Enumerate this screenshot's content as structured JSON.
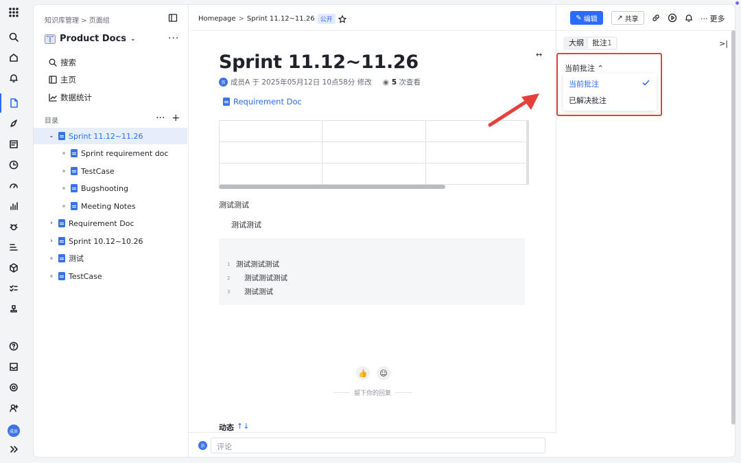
{
  "app": {
    "breadcrumb": "知识库管理 > 页面组",
    "space_name": "Product Docs"
  },
  "sidebar": {
    "nav": [
      {
        "label": "搜索",
        "icon": "search-icon"
      },
      {
        "label": "主页",
        "icon": "home-icon"
      },
      {
        "label": "数据统计",
        "icon": "stats-icon"
      }
    ],
    "toc_label": "目录",
    "tree": [
      {
        "label": "Sprint 11.12~11.26",
        "level": 0,
        "expand": "open",
        "selected": true
      },
      {
        "label": "Sprint requirement doc",
        "level": 1
      },
      {
        "label": "TestCase",
        "level": 1
      },
      {
        "label": "Bugshooting",
        "level": 1
      },
      {
        "label": "Meeting Notes",
        "level": 1
      },
      {
        "label": "Requirement Doc",
        "level": 0,
        "expand": "closed"
      },
      {
        "label": "Sprint 10.12~10.26",
        "level": 0,
        "expand": "closed"
      },
      {
        "label": "测试",
        "level": 0,
        "expand": "none"
      },
      {
        "label": "TestCase",
        "level": 0,
        "expand": "none"
      }
    ]
  },
  "topbar": {
    "crumb_home": "Homepage",
    "crumb_sep": ">",
    "crumb_current": "Sprint 11.12~11.26",
    "badge": "公开",
    "edit_label": "编辑",
    "share_label": "共享",
    "more_label": "更多"
  },
  "doc": {
    "title": "Sprint 11.12~11.26",
    "author_avatar": "员",
    "meta_text": "成员A 于 2025年05月12日 10点58分 修改",
    "views": "5",
    "views_suffix": "次查看",
    "link_label": "Requirement Doc",
    "para1": "测试测试",
    "para2": "测试测试",
    "code_lines": [
      {
        "n": "1",
        "text": "测试测试测试"
      },
      {
        "n": "2",
        "text": "测试测试测试"
      },
      {
        "n": "3",
        "text": "测试测试"
      }
    ],
    "reply_hint": "留下你的回复",
    "activity_label": "动态",
    "comment_placeholder": "评论"
  },
  "right_panel": {
    "tab_outline": "大纲",
    "tab_comments": "批注",
    "comment_count": "1",
    "filter_label": "当前批注",
    "menu": [
      {
        "label": "当前批注",
        "selected": true
      },
      {
        "label": "已解决批注",
        "selected": false
      }
    ]
  },
  "user": {
    "avatar_text": "成员"
  },
  "colors": {
    "accent": "#2b6bff",
    "highlight": "#e5413a"
  }
}
